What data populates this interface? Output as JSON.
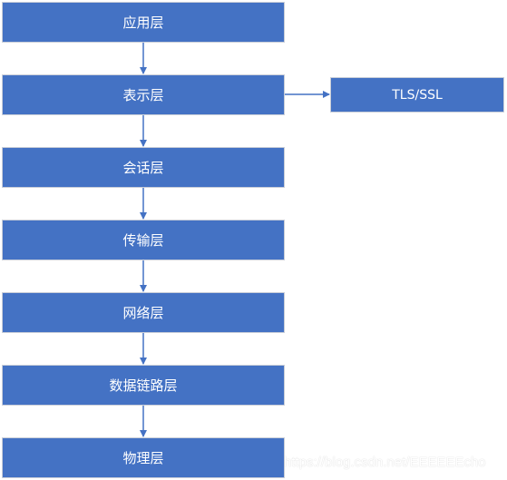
{
  "layers": [
    "应用层",
    "表示层",
    "会话层",
    "传输层",
    "网络层",
    "数据链路层",
    "物理层"
  ],
  "side_box": "TLS/SSL",
  "watermark": "https://blog.csdn.net/EEEEEEcho",
  "colors": {
    "box_fill": "#4472C4",
    "box_border": "#c9ced8",
    "arrow": "#4472C4"
  }
}
